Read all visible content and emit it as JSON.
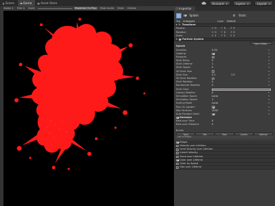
{
  "toolbar": {
    "tabs": [
      {
        "label": "Scene",
        "icon": "scene-icon"
      },
      {
        "label": "Game",
        "icon": "game-icon",
        "active": true
      },
      {
        "label": "Asset Store",
        "icon": "store-icon"
      }
    ],
    "account": "Account",
    "layers": "Layers",
    "layout": "Layout"
  },
  "game_view": {
    "display": "Display 1",
    "aspect": "Free A",
    "scale_label": "Scale",
    "maximize": "Maximize On Play",
    "mute": "Mute Audio",
    "stats": "Stats",
    "gizmos": "Gizmos"
  },
  "inspector": {
    "tab": "Inspector",
    "object_name": "Splash",
    "static": "Static",
    "tag_label": "Tag",
    "tag_value": "Untagged",
    "layer_label": "Layer",
    "layer_value": "Default",
    "transform": {
      "title": "Transform",
      "rows": [
        {
          "label": "Position",
          "x": "0",
          "y": "0",
          "z": "0"
        },
        {
          "label": "Rotation",
          "x": "0",
          "y": "0",
          "z": "0"
        },
        {
          "label": "Scale",
          "x": "1",
          "y": "1",
          "z": "1"
        }
      ]
    },
    "ps": {
      "title": "Particle System",
      "open_editor": "Open Editor...",
      "main_name": "Splash",
      "rows": [
        {
          "label": "Duration",
          "v1": "5.00",
          "v2": ""
        },
        {
          "label": "Looping",
          "v1": "",
          "v2": ""
        },
        {
          "label": "Prewarm",
          "v1": "",
          "v2": ""
        },
        {
          "label": "Start Delay",
          "v1": "0",
          "v2": ""
        },
        {
          "label": "Start Lifetime",
          "v1": "1",
          "v2": ""
        },
        {
          "label": "Start Speed",
          "v1": "0",
          "v2": ""
        },
        {
          "label": "3D Start Size",
          "v1": "",
          "v2": ""
        },
        {
          "label": "Start Size",
          "v1": "0.1",
          "v2": "1.5"
        },
        {
          "label": "3D Start Rotation",
          "v1": "",
          "v2": ""
        },
        {
          "label": "Start Rotation",
          "v1": "0",
          "v2": ""
        },
        {
          "label": "Randomize Rotation",
          "v1": "0",
          "v2": ""
        }
      ],
      "start_color_label": "Start Color",
      "start_color": "#e01818",
      "rows2": [
        {
          "label": "Gravity Modifier",
          "v1": "0",
          "v2": ""
        },
        {
          "label": "Simulation Space",
          "v1": "Local",
          "v2": ""
        },
        {
          "label": "Simulation Speed",
          "v1": "1",
          "v2": ""
        },
        {
          "label": "Scaling Mode",
          "v1": "Local",
          "v2": ""
        },
        {
          "label": "Play On Awake*",
          "v1": "",
          "v2": ""
        },
        {
          "label": "Max Particles",
          "v1": "1000",
          "v2": ""
        },
        {
          "label": "Auto Random Seed",
          "v1": "",
          "v2": ""
        }
      ],
      "emission_title": "Emission",
      "emission_rows": [
        {
          "label": "Rate over Time",
          "v1": "0"
        },
        {
          "label": "Rate over Distance",
          "v1": "0"
        }
      ],
      "bursts_label": "Bursts",
      "burst_cols": [
        "Time",
        "Min",
        "Max",
        "Cycles",
        "Interval"
      ],
      "list_empty": "List is Empty",
      "modules": [
        {
          "label": "Shape",
          "on": true
        },
        {
          "label": "Velocity over Lifetime",
          "on": false
        },
        {
          "label": "Limit Velocity over Lifetime",
          "on": false
        },
        {
          "label": "Inherit Velocity",
          "on": false
        },
        {
          "label": "Force over Lifetime",
          "on": false
        },
        {
          "label": "Color over Lifetime",
          "on": true
        },
        {
          "label": "Color by Speed",
          "on": false
        },
        {
          "label": "Size over Lifetime",
          "on": false
        }
      ]
    }
  },
  "colors": {
    "splash": "#ff1a1a",
    "accent_check": "#e0e0e0"
  }
}
